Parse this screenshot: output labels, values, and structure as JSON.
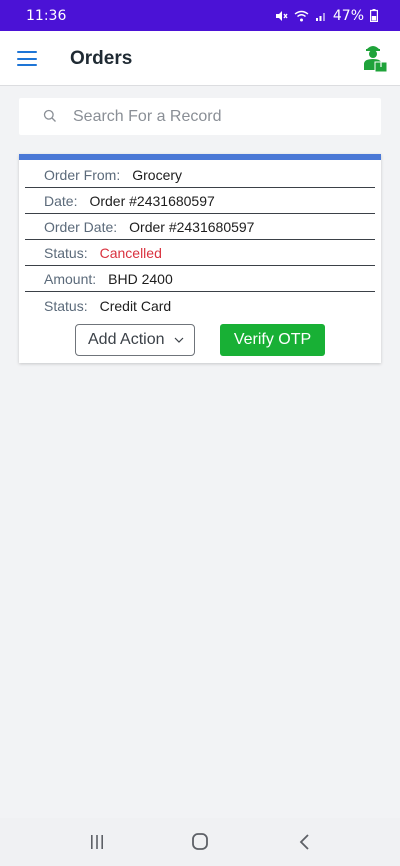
{
  "status_bar": {
    "time": "11:36",
    "battery": "47%"
  },
  "app_bar": {
    "title": "Orders"
  },
  "search": {
    "placeholder": "Search For a Record",
    "value": ""
  },
  "order": {
    "rows": [
      {
        "label": "Order From:",
        "value": "Grocery"
      },
      {
        "label": "Date:",
        "value": "Order #2431680597"
      },
      {
        "label": "Order Date:",
        "value": "Order #2431680597"
      },
      {
        "label": "Status:",
        "value": "Cancelled"
      },
      {
        "label": "Amount:",
        "value": "BHD 2400"
      },
      {
        "label": "Status:",
        "value": "Credit Card"
      }
    ],
    "add_action_label": "Add Action",
    "verify_label": "Verify OTP"
  },
  "colors": {
    "status_bar": "#4b12d6",
    "accent": "#1e75d6",
    "card_top": "#4a78d6",
    "cancelled": "#d9323f",
    "verify": "#18b035"
  },
  "icons": [
    "menu-icon",
    "delivery-user-icon",
    "search-icon",
    "chevron-down-icon",
    "mute-icon",
    "wifi-icon",
    "signal-icon",
    "battery-icon",
    "recents-icon",
    "home-icon",
    "back-icon"
  ]
}
